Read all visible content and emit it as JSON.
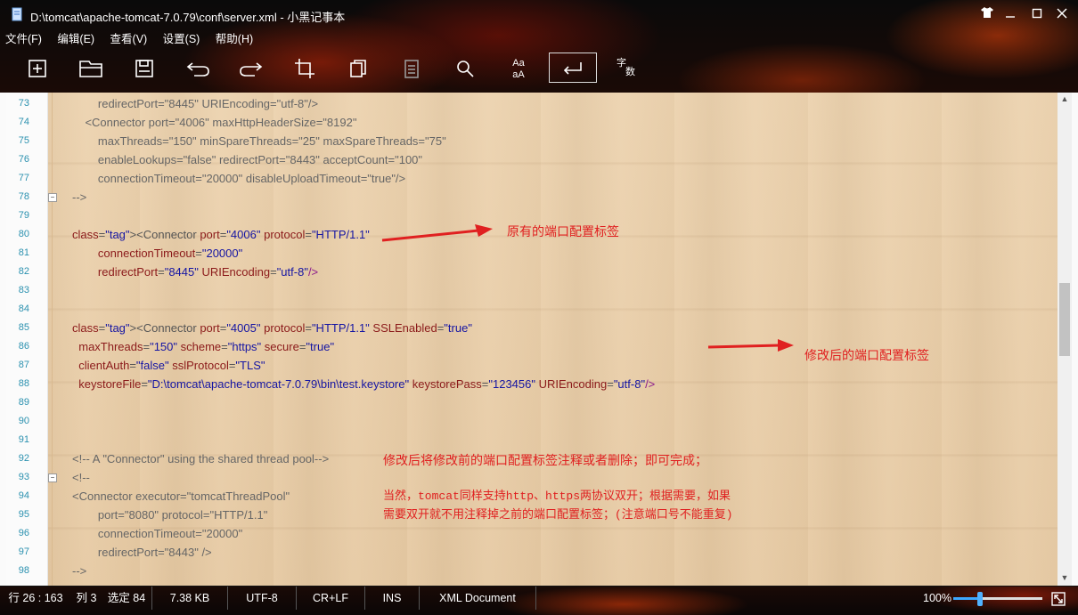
{
  "window": {
    "title": "D:\\tomcat\\apache-tomcat-7.0.79\\conf\\server.xml - 小黑记事本",
    "controls": [
      "shirt-icon",
      "minimize-icon",
      "maximize-icon",
      "close-icon"
    ]
  },
  "menu": {
    "items": [
      "文件(F)",
      "编辑(E)",
      "查看(V)",
      "设置(S)",
      "帮助(H)"
    ]
  },
  "toolbar": {
    "tools": [
      {
        "name": "new-file",
        "icon": "plus-square-icon"
      },
      {
        "name": "open-file",
        "icon": "folder-icon"
      },
      {
        "name": "save-file",
        "icon": "save-icon"
      },
      {
        "name": "undo",
        "icon": "undo-icon"
      },
      {
        "name": "redo",
        "icon": "redo-icon"
      },
      {
        "name": "crop",
        "icon": "crop-icon"
      },
      {
        "name": "copy",
        "icon": "copy-icon"
      },
      {
        "name": "paste",
        "icon": "clipboard-icon"
      },
      {
        "name": "search",
        "icon": "search-icon"
      },
      {
        "name": "case-convert",
        "icon": "case-icon"
      },
      {
        "name": "wrap",
        "icon": "return-icon",
        "active": true
      },
      {
        "name": "word-count",
        "icon": "word-count-icon"
      }
    ],
    "case_label_top": "Aa",
    "case_label_bottom": "aA",
    "word_count_top": "字",
    "word_count_bottom": "数"
  },
  "editor": {
    "lines": [
      {
        "n": "73",
        "text": "        redirectPort=\"8445\" URIEncoding=\"utf-8\"/>"
      },
      {
        "n": "74",
        "text": "    <Connector port=\"4006\" maxHttpHeaderSize=\"8192\""
      },
      {
        "n": "75",
        "text": "        maxThreads=\"150\" minSpareThreads=\"25\" maxSpareThreads=\"75\""
      },
      {
        "n": "76",
        "text": "        enableLookups=\"false\" redirectPort=\"8443\" acceptCount=\"100\""
      },
      {
        "n": "77",
        "text": "        connectionTimeout=\"20000\" disableUploadTimeout=\"true\"/>"
      },
      {
        "n": "78",
        "text": "-->"
      },
      {
        "n": "79",
        "text": ""
      },
      {
        "n": "80",
        "text": "<Connector port=\"4006\" protocol=\"HTTP/1.1\""
      },
      {
        "n": "81",
        "text": "        connectionTimeout=\"20000\""
      },
      {
        "n": "82",
        "text": "        redirectPort=\"8445\" URIEncoding=\"utf-8\"/>"
      },
      {
        "n": "83",
        "text": ""
      },
      {
        "n": "84",
        "text": ""
      },
      {
        "n": "85",
        "text": "<Connector port=\"4005\" protocol=\"HTTP/1.1\" SSLEnabled=\"true\""
      },
      {
        "n": "86",
        "text": "  maxThreads=\"150\" scheme=\"https\" secure=\"true\""
      },
      {
        "n": "87",
        "text": "  clientAuth=\"false\" sslProtocol=\"TLS\""
      },
      {
        "n": "88",
        "text": "  keystoreFile=\"D:\\tomcat\\apache-tomcat-7.0.79\\bin\\test.keystore\" keystorePass=\"123456\" URIEncoding=\"utf-8\"/>"
      },
      {
        "n": "89",
        "text": ""
      },
      {
        "n": "90",
        "text": ""
      },
      {
        "n": "91",
        "text": ""
      },
      {
        "n": "92",
        "text": "<!-- A \"Connector\" using the shared thread pool-->"
      },
      {
        "n": "93",
        "text": "<!--"
      },
      {
        "n": "94",
        "text": "<Connector executor=\"tomcatThreadPool\""
      },
      {
        "n": "95",
        "text": "        port=\"8080\" protocol=\"HTTP/1.1\""
      },
      {
        "n": "96",
        "text": "        connectionTimeout=\"20000\""
      },
      {
        "n": "97",
        "text": "        redirectPort=\"8443\" />"
      },
      {
        "n": "98",
        "text": "-->"
      }
    ],
    "annotations": {
      "original": "原有的端口配置标签",
      "modified": "修改后的端口配置标签",
      "comment_out": "修改后将修改前的端口配置标签注释或者删除；即可完成；",
      "dual_line1": "当然，tomcat同样支持http、https两协议双开；根据需要，如果",
      "dual_line2": "需要双开就不用注释掉之前的端口配置标签；(注意端口号不能重复)"
    },
    "scroll_position_fraction": 0.45,
    "accent_color": "#e02020"
  },
  "status": {
    "position": "行 26 : 163",
    "column": "列 3",
    "selected": "选定 84",
    "size": "7.38 KB",
    "encoding": "UTF-8",
    "line_ending": "CR+LF",
    "mode": "INS",
    "doc_type": "XML Document",
    "zoom": "100%",
    "zoom_fraction": 0.3
  }
}
